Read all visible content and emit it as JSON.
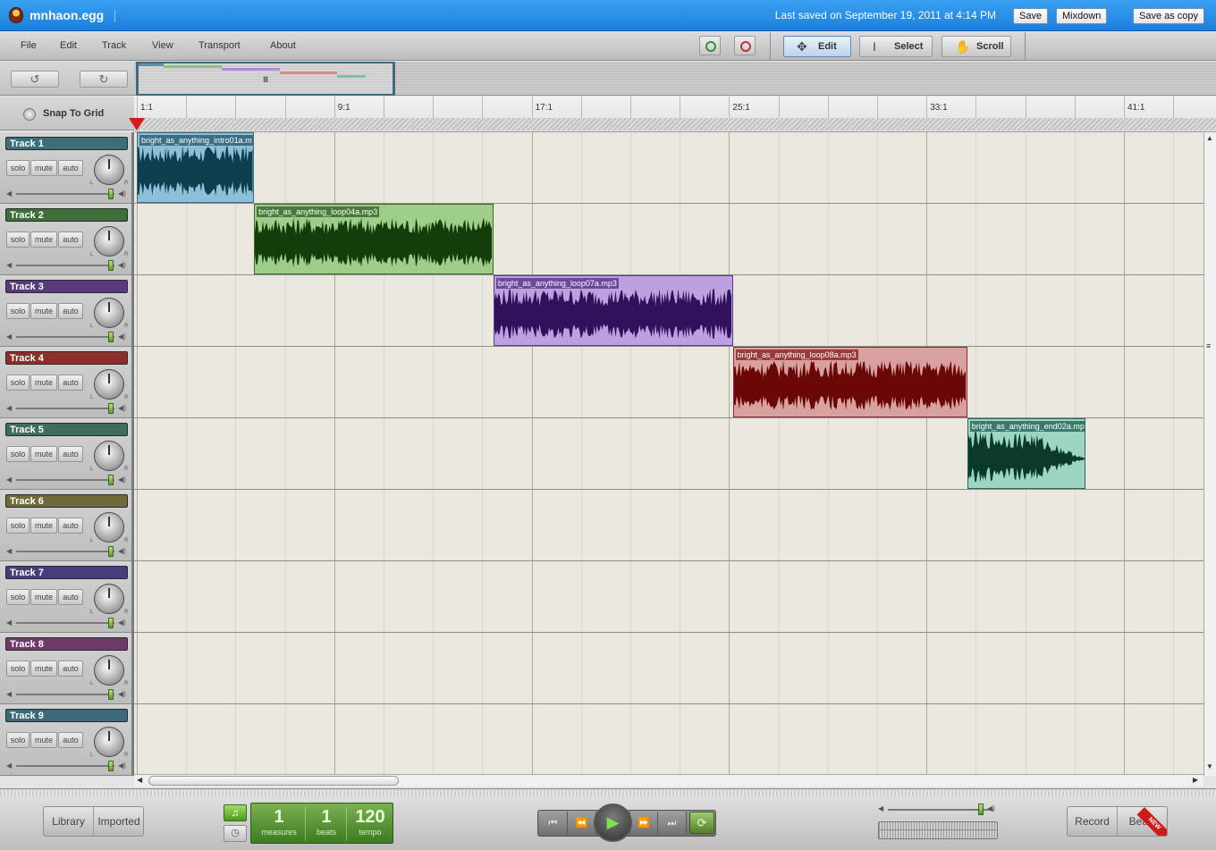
{
  "app": {
    "title": "mnhaon.egg",
    "status": "Last saved on September 19, 2011 at 4:14 PM",
    "buttons": {
      "save": "Save",
      "mixdown": "Mixdown",
      "save_as_copy": "Save as copy"
    }
  },
  "menu": {
    "file": "File",
    "edit": "Edit",
    "track": "Track",
    "view": "View",
    "transport": "Transport",
    "about": "About"
  },
  "modes": {
    "edit": "Edit",
    "select": "Select",
    "scroll": "Scroll",
    "active": "Edit"
  },
  "toolbar_icons": {
    "zoom_in": "zoom-in-icon",
    "zoom_out": "zoom-out-icon",
    "undo": "undo-icon",
    "redo": "redo-icon"
  },
  "snap": {
    "label": "Snap To Grid",
    "enabled": false
  },
  "ruler": {
    "labels": [
      "1:1",
      "9:1",
      "17:1",
      "25:1",
      "33:1",
      "41:1"
    ],
    "playhead_measure": 1
  },
  "track_controls": {
    "solo": "solo",
    "mute": "mute",
    "auto": "auto",
    "pan_left": "L",
    "pan_right": "R"
  },
  "tracks": [
    {
      "name": "Track 1",
      "color": "#3c6e7a",
      "volume": 1.0
    },
    {
      "name": "Track 2",
      "color": "#3e6e3a",
      "volume": 1.0
    },
    {
      "name": "Track 3",
      "color": "#5a3a7e",
      "volume": 1.0
    },
    {
      "name": "Track 4",
      "color": "#8e2e2a",
      "volume": 1.0
    },
    {
      "name": "Track 5",
      "color": "#3c6e5a",
      "volume": 1.0
    },
    {
      "name": "Track 6",
      "color": "#6e6a3a",
      "volume": 1.0
    },
    {
      "name": "Track 7",
      "color": "#4a3a7e",
      "volume": 1.0
    },
    {
      "name": "Track 8",
      "color": "#6e3a6a",
      "volume": 1.0
    },
    {
      "name": "Track 9",
      "color": "#3c6a7a",
      "volume": 1.0
    }
  ],
  "clips": [
    {
      "track": 0,
      "name": "bright_as_anything_intro01a.m",
      "start_measure": 1,
      "length_measures": 4.75,
      "wave": "#0f3f4f",
      "bg": "#8cc0d8",
      "border": "#3a6f8a",
      "label_bg": "#3b6f82"
    },
    {
      "track": 1,
      "name": "bright_as_anything_loop04a.mp3",
      "start_measure": 5.75,
      "length_measures": 9.7,
      "wave": "#153d0c",
      "bg": "#9fce8a",
      "border": "#3a6a2a",
      "label_bg": "#4a7a3a"
    },
    {
      "track": 2,
      "name": "bright_as_anything_loop07a.mp3",
      "start_measure": 15.45,
      "length_measures": 9.7,
      "wave": "#31105c",
      "bg": "#bda0e0",
      "border": "#5a3a8a",
      "label_bg": "#6a4a9a"
    },
    {
      "track": 3,
      "name": "bright_as_anything_loop08a.mp3",
      "start_measure": 25.15,
      "length_measures": 9.5,
      "wave": "#6a0707",
      "bg": "#d9a0a0",
      "border": "#8a2a2a",
      "label_bg": "#9a3a3a"
    },
    {
      "track": 4,
      "name": "bright_as_anything_end02a.mp",
      "start_measure": 34.65,
      "length_measures": 4.8,
      "wave": "#0b3a2a",
      "bg": "#9cd6c2",
      "border": "#2a6a5a",
      "label_bg": "#3a7a6a"
    }
  ],
  "transport": {
    "measures": "1",
    "beats": "1",
    "tempo": "120",
    "measures_label": "measures",
    "beats_label": "beats",
    "tempo_label": "tempo",
    "master_volume": 0.9
  },
  "bottom": {
    "library": "Library",
    "imported": "Imported",
    "record": "Record",
    "beats": "Beats",
    "new_badge": "NEW"
  }
}
